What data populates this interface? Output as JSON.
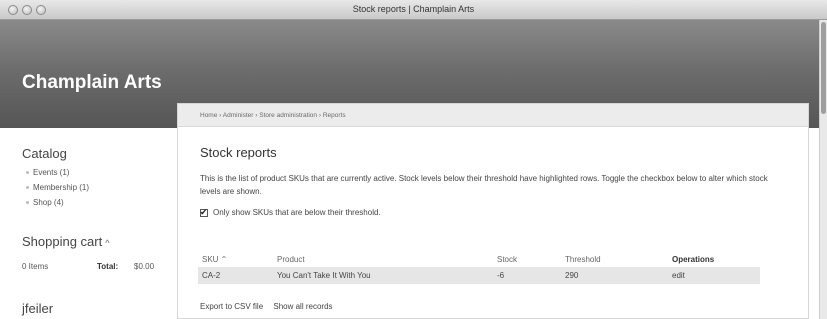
{
  "window": {
    "title": "Stock reports | Champlain Arts"
  },
  "site": {
    "name": "Champlain Arts"
  },
  "sidebar": {
    "catalog_title": "Catalog",
    "catalog_items": [
      {
        "label": "Events (1)"
      },
      {
        "label": "Membership (1)"
      },
      {
        "label": "Shop (4)"
      }
    ],
    "cart_title": "Shopping cart",
    "cart_caret": "^",
    "cart_items": "0 Items",
    "cart_total_label": "Total:",
    "cart_total_value": "$0.00",
    "user_title": "jfeiler"
  },
  "breadcrumb": "Home › Administer › Store administration › Reports",
  "page": {
    "title": "Stock reports",
    "description": "This is the list of product SKUs that are currently active. Stock levels below their threshold have highlighted rows. Toggle the checkbox below to alter which stock levels are shown.",
    "filter_label": "Only show SKUs that are below their threshold.",
    "filter_checked": true
  },
  "table": {
    "headers": {
      "sku": "SKU ⌃",
      "product": "Product",
      "stock": "Stock",
      "threshold": "Threshold",
      "operations": "Operations"
    },
    "rows": [
      {
        "sku": "CA-2",
        "product": "You Can't Take It With You",
        "stock": "-6",
        "threshold": "290",
        "operations": "edit"
      }
    ]
  },
  "links": {
    "export": "Export to CSV file",
    "show_all": "Show all records"
  },
  "colors": {
    "header_bg": "#6d6d6d",
    "highlight_row": "#e6e6e6"
  }
}
